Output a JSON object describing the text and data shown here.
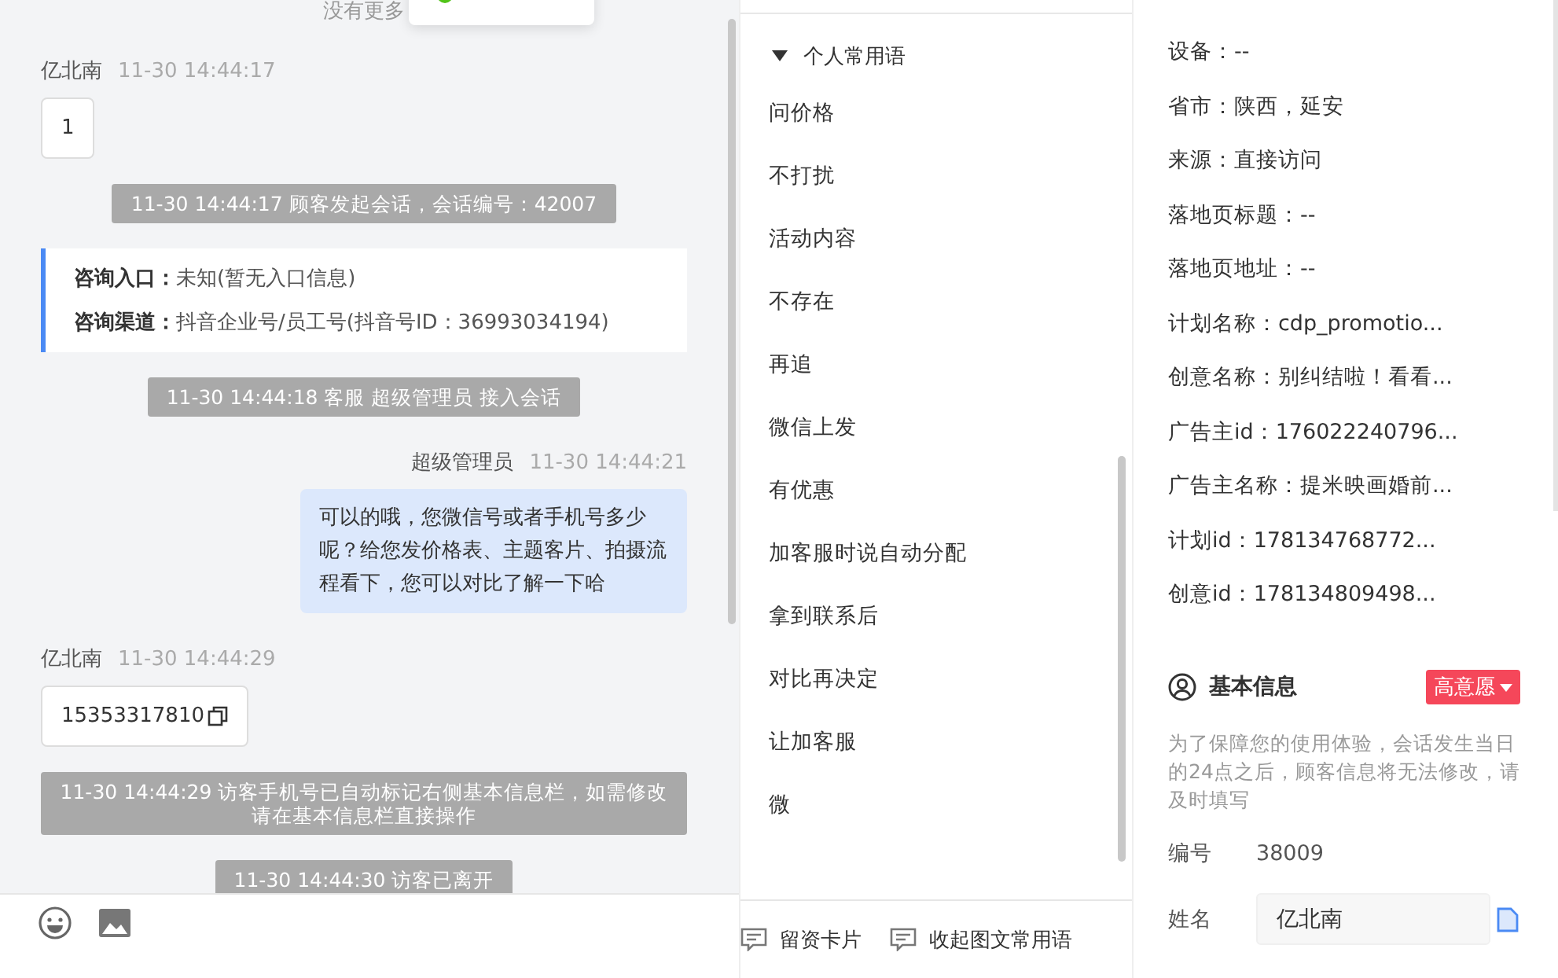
{
  "chat": {
    "no_more": "没有更多",
    "messages": [
      {
        "kind": "customer",
        "name": "亿北南",
        "time": "11-30 14:44:17",
        "text": "1",
        "copyable": false
      },
      {
        "kind": "system",
        "text": "11-30 14:44:17 顾客发起会话，会话编号：42007"
      },
      {
        "kind": "info",
        "rows": [
          {
            "label": "咨询入口：",
            "value": "未知(暂无入口信息)"
          },
          {
            "label": "咨询渠道：",
            "value": "抖音企业号/员工号(抖音号ID：36993034194)"
          }
        ]
      },
      {
        "kind": "system",
        "text": "11-30 14:44:18 客服 超级管理员 接入会话"
      },
      {
        "kind": "agent",
        "name": "超级管理员",
        "time": "11-30 14:44:21",
        "text": "可以的哦，您微信号或者手机号多少呢？给您发价格表、主题客片、拍摄流程看下，您可以对比了解一下哈"
      },
      {
        "kind": "customer",
        "name": "亿北南",
        "time": "11-30 14:44:29",
        "text": "15353317810",
        "copyable": true
      },
      {
        "kind": "system",
        "text": "11-30 14:44:29 访客手机号已自动标记右侧基本信息栏，如需修改请在基本信息栏直接操作"
      },
      {
        "kind": "system",
        "text": "11-30 14:44:30 访客已离开"
      }
    ]
  },
  "phrases": {
    "group": "个人常用语",
    "expanded": true,
    "items": [
      "问价格",
      "不打扰",
      "活动内容",
      "不存在",
      "再追",
      "微信上发",
      "有优惠",
      "加客服时说自动分配",
      "拿到联系后",
      "对比再决定",
      "让加客服",
      "微"
    ],
    "actions": [
      "留资卡片",
      "收起图文常用语"
    ]
  },
  "source_info": {
    "rows": [
      "设备：--",
      "省市：陕西，延安",
      "来源：直接访问",
      "落地页标题：--",
      "落地页地址：--",
      "计划名称：cdp_promotio...",
      "创意名称：别纠结啦！看看...",
      "广告主id：176022240796...",
      "广告主名称：提米映画婚前...",
      "计划id：178134768772...",
      "创意id：178134809498..."
    ]
  },
  "basic_info": {
    "title": "基本信息",
    "intent": "高意愿",
    "note": "为了保障您的使用体验，会话发生当日的24点之后，顾客信息将无法修改，请及时填写",
    "fields": [
      {
        "kind": "text",
        "label": "编号",
        "value": "38009"
      },
      {
        "kind": "input",
        "label": "姓名",
        "value": "亿北南"
      }
    ]
  }
}
